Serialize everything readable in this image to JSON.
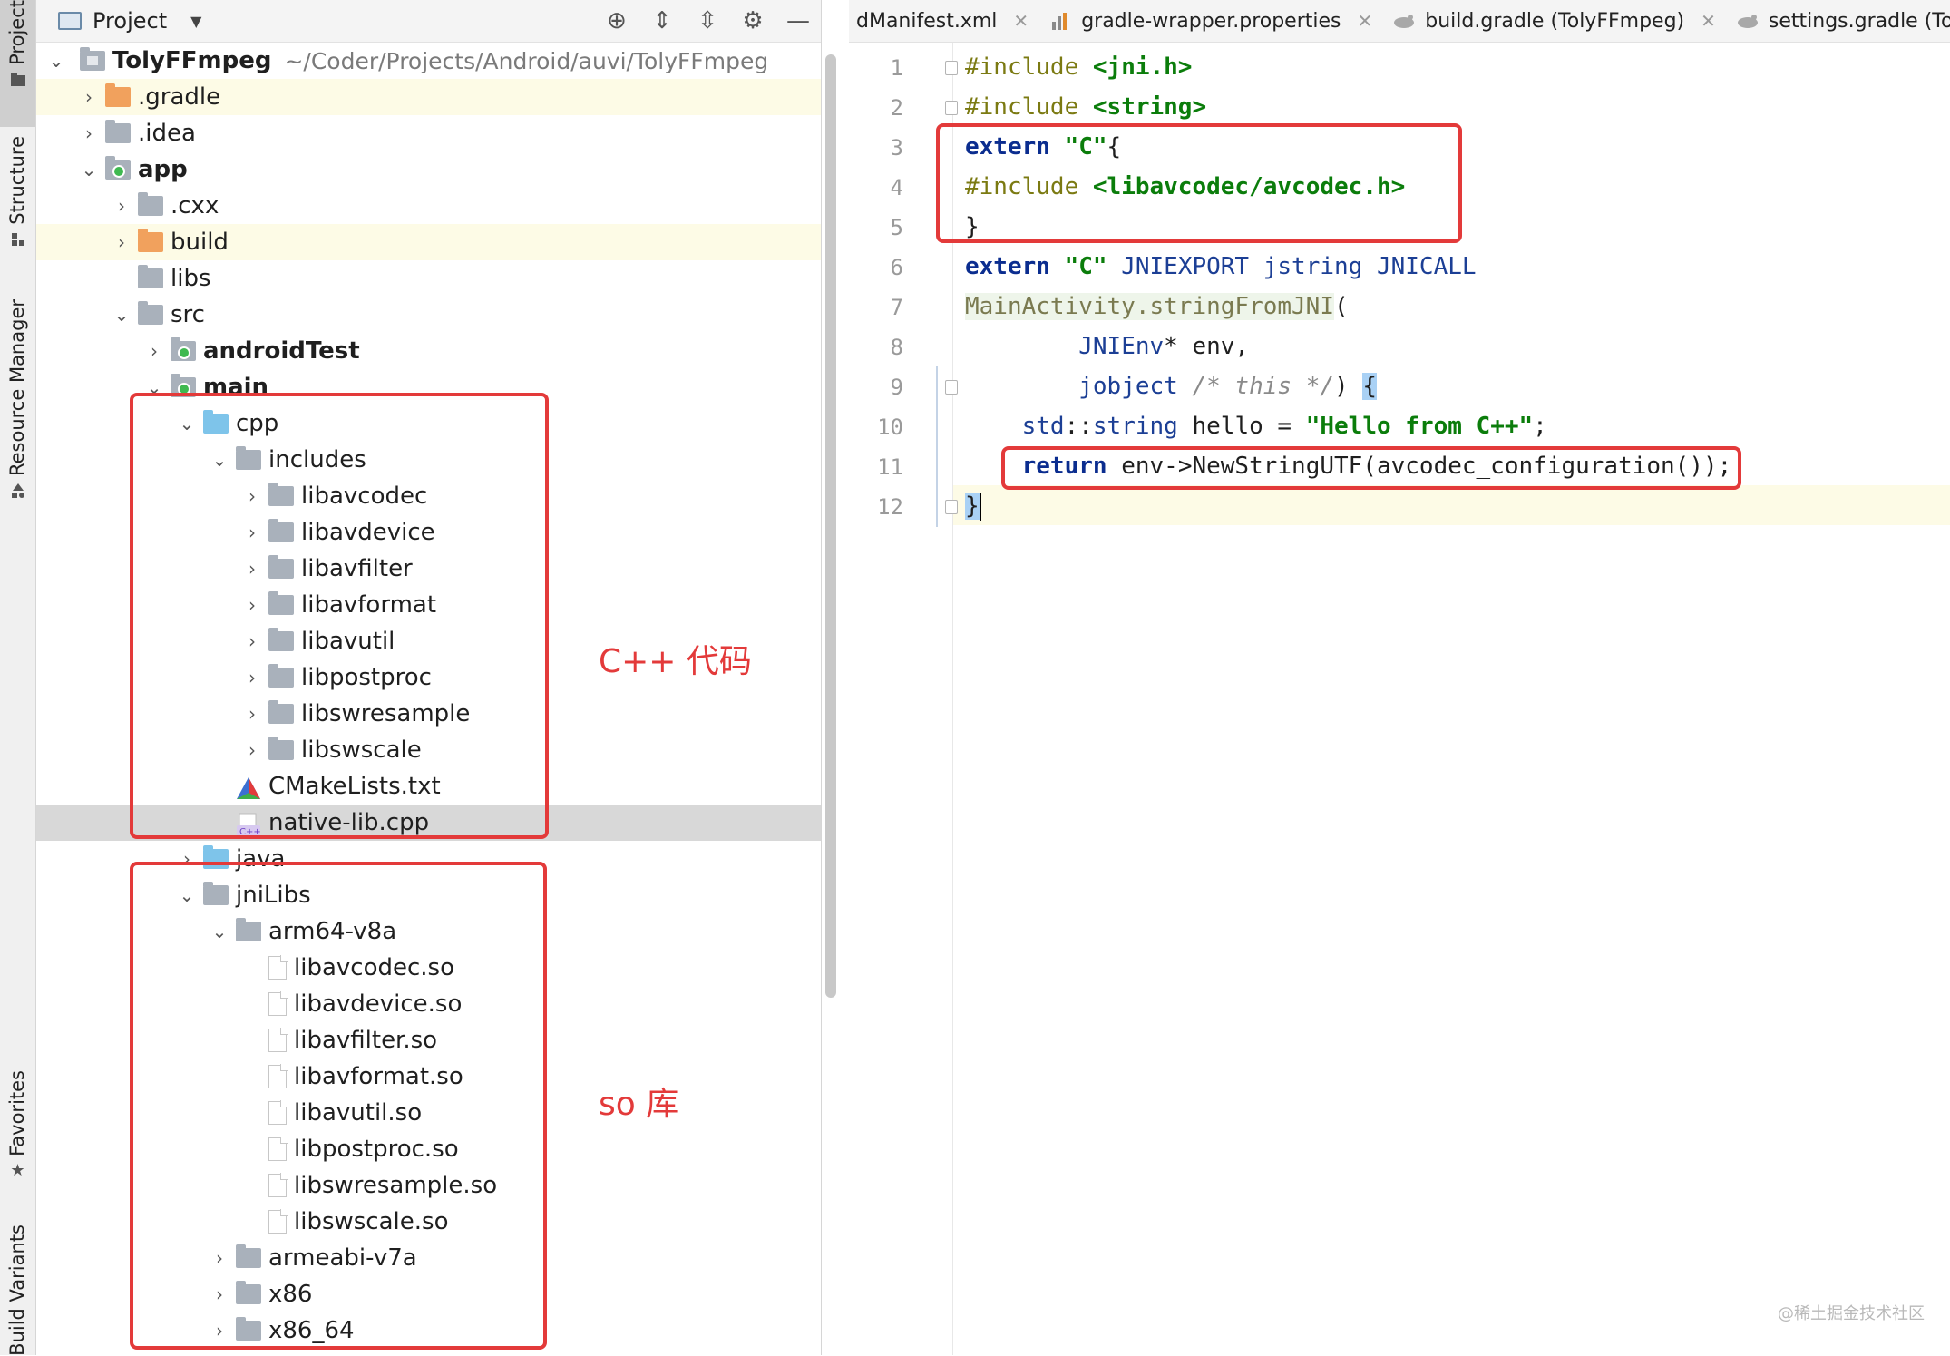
{
  "tool_strip": {
    "tabs": [
      {
        "label": "Project",
        "icon": "folder-icon",
        "active": true
      },
      {
        "label": "Structure",
        "icon": "structure-icon",
        "active": false
      },
      {
        "label": "Resource Manager",
        "icon": "resource-manager-icon",
        "active": false
      },
      {
        "label": "Favorites",
        "icon": "star-icon",
        "active": false
      },
      {
        "label": "Build Variants",
        "icon": "build-variants-icon",
        "active": false
      }
    ]
  },
  "project_panel": {
    "title": "Project",
    "toolbar_icons": [
      "locate-icon",
      "expand-all-icon",
      "collapse-all-icon",
      "gear-icon",
      "hide-icon"
    ],
    "root": {
      "name": "TolyFFmpeg",
      "path": "~/Coder/Projects/Android/auvi/TolyFFmpeg"
    },
    "tree": [
      {
        "label": ".gradle",
        "arrow": "›",
        "icon": "folder-orange"
      },
      {
        "label": ".idea",
        "arrow": "›",
        "icon": "folder"
      },
      {
        "label": "app",
        "arrow": "⌄",
        "icon": "folder-module",
        "bold": true
      },
      {
        "label": ".cxx",
        "arrow": "›",
        "icon": "folder"
      },
      {
        "label": "build",
        "arrow": "›",
        "icon": "folder-orange"
      },
      {
        "label": "libs",
        "arrow": "",
        "icon": "folder"
      },
      {
        "label": "src",
        "arrow": "⌄",
        "icon": "folder"
      },
      {
        "label": "androidTest",
        "arrow": "›",
        "icon": "folder-module",
        "bold": true
      },
      {
        "label": "main",
        "arrow": "⌄",
        "icon": "folder-module",
        "bold": true
      },
      {
        "label": "cpp",
        "arrow": "⌄",
        "icon": "folder-blue"
      },
      {
        "label": "includes",
        "arrow": "⌄",
        "icon": "folder"
      },
      {
        "label": "libavcodec",
        "arrow": "›",
        "icon": "folder"
      },
      {
        "label": "libavdevice",
        "arrow": "›",
        "icon": "folder"
      },
      {
        "label": "libavfilter",
        "arrow": "›",
        "icon": "folder"
      },
      {
        "label": "libavformat",
        "arrow": "›",
        "icon": "folder"
      },
      {
        "label": "libavutil",
        "arrow": "›",
        "icon": "folder"
      },
      {
        "label": "libpostproc",
        "arrow": "›",
        "icon": "folder"
      },
      {
        "label": "libswresample",
        "arrow": "›",
        "icon": "folder"
      },
      {
        "label": "libswscale",
        "arrow": "›",
        "icon": "folder"
      },
      {
        "label": "CMakeLists.txt",
        "arrow": "",
        "icon": "cmake"
      },
      {
        "label": "native-lib.cpp",
        "arrow": "",
        "icon": "cpp-file",
        "selected": true
      },
      {
        "label": "java",
        "arrow": "›",
        "icon": "folder-blue"
      },
      {
        "label": "jniLibs",
        "arrow": "⌄",
        "icon": "folder"
      },
      {
        "label": "arm64-v8a",
        "arrow": "⌄",
        "icon": "folder"
      },
      {
        "label": "libavcodec.so",
        "arrow": "",
        "icon": "file"
      },
      {
        "label": "libavdevice.so",
        "arrow": "",
        "icon": "file"
      },
      {
        "label": "libavfilter.so",
        "arrow": "",
        "icon": "file"
      },
      {
        "label": "libavformat.so",
        "arrow": "",
        "icon": "file"
      },
      {
        "label": "libavutil.so",
        "arrow": "",
        "icon": "file"
      },
      {
        "label": "libpostproc.so",
        "arrow": "",
        "icon": "file"
      },
      {
        "label": "libswresample.so",
        "arrow": "",
        "icon": "file"
      },
      {
        "label": "libswscale.so",
        "arrow": "",
        "icon": "file"
      },
      {
        "label": "armeabi-v7a",
        "arrow": "›",
        "icon": "folder"
      },
      {
        "label": "x86",
        "arrow": "›",
        "icon": "folder"
      },
      {
        "label": "x86_64",
        "arrow": "›",
        "icon": "folder"
      }
    ]
  },
  "annotations": {
    "cpp_label": "C++ 代码",
    "so_label": "so 库",
    "color": "#e33a3a"
  },
  "editor": {
    "tabs": [
      {
        "label": "dManifest.xml",
        "icon": "xml-icon"
      },
      {
        "label": "gradle-wrapper.properties",
        "icon": "properties-icon"
      },
      {
        "label": "build.gradle (TolyFFmpeg)",
        "icon": "gradle-icon"
      },
      {
        "label": "settings.gradle (TolyFFmpeg)",
        "icon": "gradle-icon"
      }
    ],
    "line_numbers": [
      "1",
      "2",
      "3",
      "4",
      "5",
      "6",
      "7",
      "8",
      "9",
      "10",
      "11",
      "12"
    ],
    "code": {
      "l1_kw": "#include",
      "l1_str": "<jni.h>",
      "l2_kw": "#include",
      "l2_str": "<string>",
      "l3_kw": "extern",
      "l3_str": "\"C\"",
      "l3_rest": "{",
      "l4_kw": "#include",
      "l4_str": "<libavcodec/avcodec.h>",
      "l5": "}",
      "l6_kw": "extern",
      "l6_str": "\"C\"",
      "l6_ty": "JNIEXPORT jstring JNICALL",
      "l7_fn": "MainActivity.stringFromJNI",
      "l7_rest": "(",
      "l8_ty": "JNIEnv",
      "l8_rest": "* env,",
      "l9_ty": "jobject",
      "l9_cm": "/* this */",
      "l9_rest": ")",
      "l9_brace": "{",
      "l10_ns": "std",
      "l10_ty": "string",
      "l10_rest": " hello = ",
      "l10_str": "\"Hello from C++\"",
      "l10_end": ";",
      "l11_kw": "return",
      "l11_rest": " env->NewStringUTF(avcodec_configuration());",
      "l12": "}"
    }
  },
  "watermark": "@稀土掘金技术社区"
}
